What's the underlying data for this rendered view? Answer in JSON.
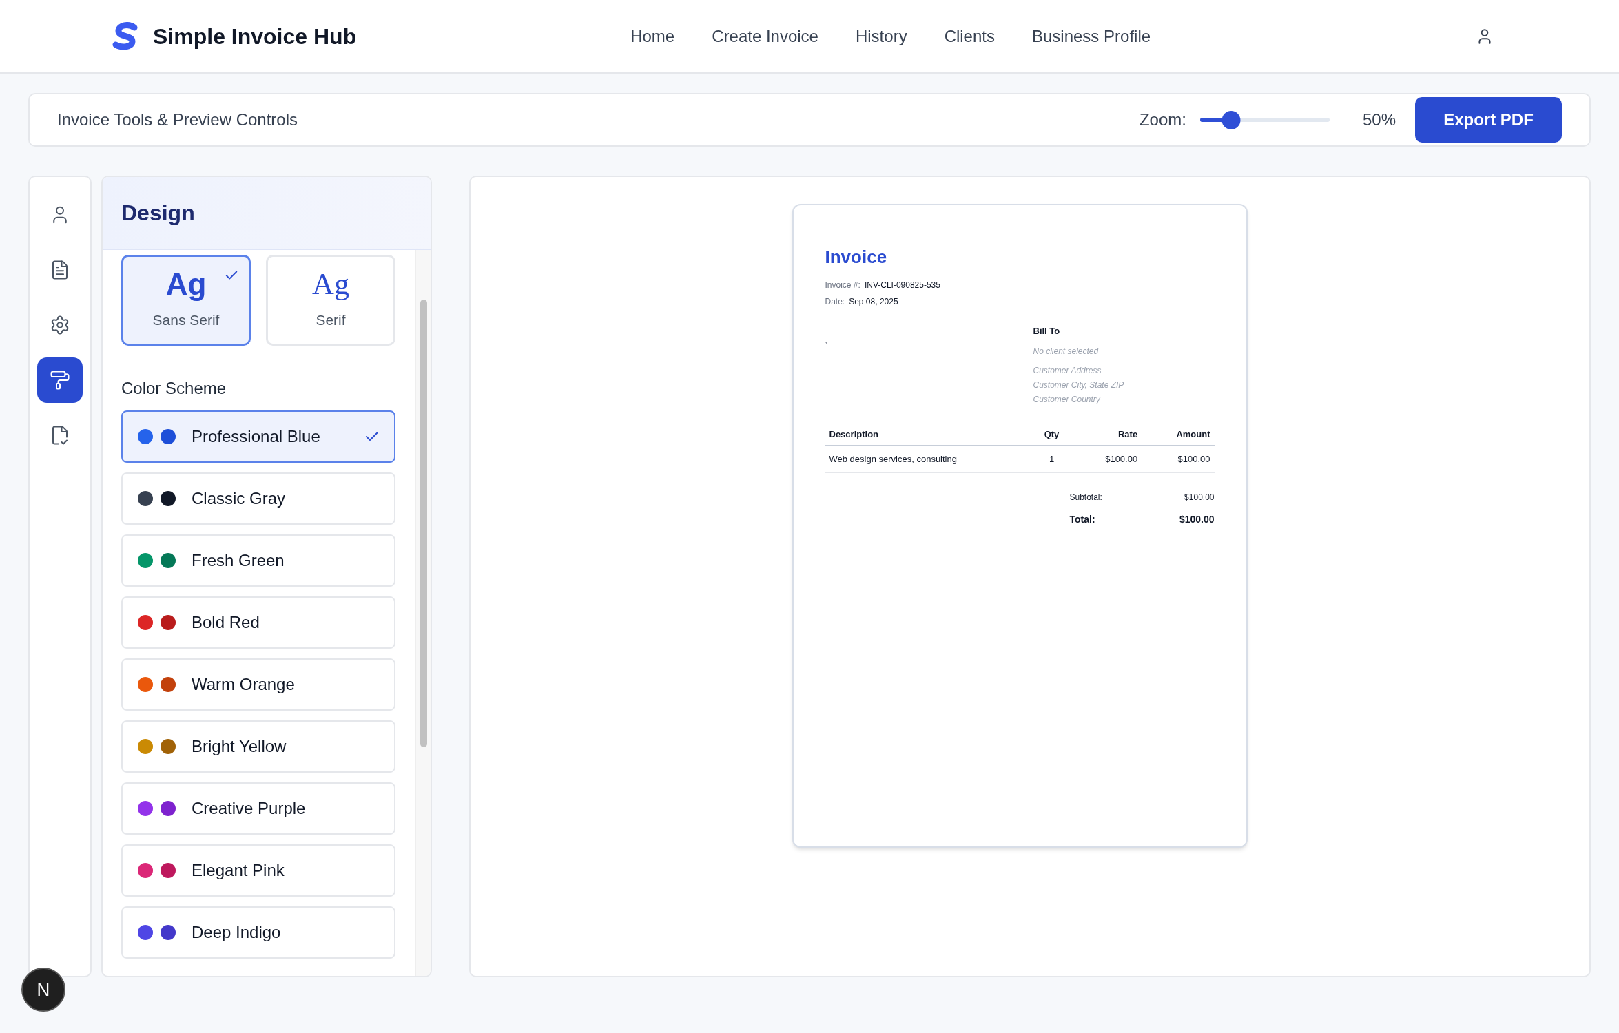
{
  "app": {
    "title": "Simple Invoice Hub"
  },
  "nav": [
    {
      "label": "Home"
    },
    {
      "label": "Create Invoice"
    },
    {
      "label": "History"
    },
    {
      "label": "Clients"
    },
    {
      "label": "Business Profile"
    }
  ],
  "toolbar": {
    "title": "Invoice Tools & Preview Controls",
    "zoom_label": "Zoom:",
    "zoom": {
      "level": 0.24
    },
    "zoom_reading": "50%",
    "export_button": "Export PDF"
  },
  "rail": [
    {
      "kind": "user",
      "selected": false
    },
    {
      "kind": "document",
      "selected": false
    },
    {
      "kind": "settings",
      "selected": false
    },
    {
      "kind": "roller",
      "selected": true
    },
    {
      "kind": "badge",
      "selected": false
    }
  ],
  "design_panel": {
    "title": "Design",
    "fonts": [
      {
        "kind": "sans",
        "sample": "Ag",
        "label": "Sans Serif",
        "selected": true
      },
      {
        "kind": "serif",
        "sample": "Ag",
        "label": "Serif",
        "selected": false
      }
    ],
    "color_scheme_label": "Color Scheme",
    "color_schemes": [
      {
        "name": "Professional Blue",
        "selected": true,
        "dots": [
          {
            "color": "#2563eb"
          },
          {
            "color": "#1d4ed8"
          }
        ]
      },
      {
        "name": "Classic Gray",
        "selected": false,
        "dots": [
          {
            "color": "#374151"
          },
          {
            "color": "#111827"
          }
        ]
      },
      {
        "name": "Fresh Green",
        "selected": false,
        "dots": [
          {
            "color": "#059669"
          },
          {
            "color": "#047857"
          }
        ]
      },
      {
        "name": "Bold Red",
        "selected": false,
        "dots": [
          {
            "color": "#dc2626"
          },
          {
            "color": "#b91c1c"
          }
        ]
      },
      {
        "name": "Warm Orange",
        "selected": false,
        "dots": [
          {
            "color": "#ea580c"
          },
          {
            "color": "#c2410c"
          }
        ]
      },
      {
        "name": "Bright Yellow",
        "selected": false,
        "dots": [
          {
            "color": "#ca8a04"
          },
          {
            "color": "#a16207"
          }
        ]
      },
      {
        "name": "Creative Purple",
        "selected": false,
        "dots": [
          {
            "color": "#9333ea"
          },
          {
            "color": "#7e22ce"
          }
        ]
      },
      {
        "name": "Elegant Pink",
        "selected": false,
        "dots": [
          {
            "color": "#db2777"
          },
          {
            "color": "#be185d"
          }
        ]
      },
      {
        "name": "Deep Indigo",
        "selected": false,
        "dots": [
          {
            "color": "#4f46e5"
          },
          {
            "color": "#4338ca"
          }
        ]
      }
    ]
  },
  "invoice": {
    "title": "Invoice",
    "meta": [
      {
        "label": "Invoice #:",
        "value": "INV-CLI-090825-535"
      },
      {
        "label": "Date:",
        "value": "Sep 08, 2025"
      }
    ],
    "from_text": ",",
    "bill_to": {
      "heading": "Bill To",
      "client": "No client selected",
      "address_lines": [
        "Customer Address",
        "Customer City, State ZIP",
        "Customer Country"
      ]
    },
    "table": {
      "columns": [
        "Description",
        "Qty",
        "Rate",
        "Amount"
      ],
      "rows": [
        [
          "Web design services, consulting",
          "1",
          "$100.00",
          "$100.00"
        ]
      ]
    },
    "totals": [
      {
        "kind": "subtotal",
        "label": "Subtotal:",
        "value": "$100.00"
      },
      {
        "kind": "total",
        "label": "Total:",
        "value": "$100.00"
      }
    ]
  },
  "dev_badge": {
    "label": "N"
  }
}
